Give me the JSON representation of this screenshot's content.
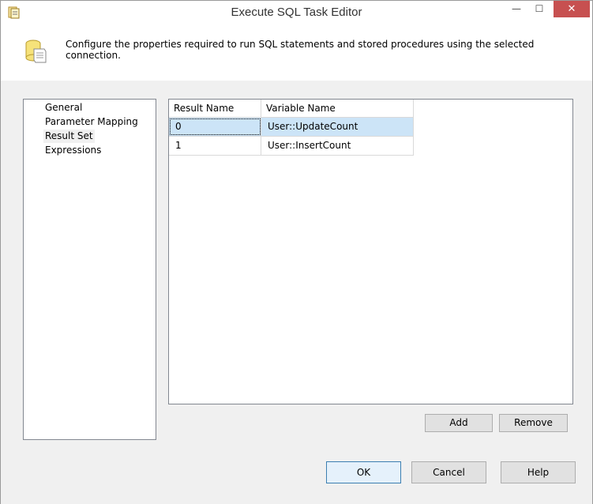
{
  "window": {
    "title": "Execute SQL Task Editor",
    "minimize_glyph": "—",
    "maximize_glyph": "☐",
    "close_glyph": "✕"
  },
  "header": {
    "description": "Configure the properties required to run SQL statements and stored procedures using the selected connection."
  },
  "nav": {
    "items": [
      {
        "label": "General"
      },
      {
        "label": "Parameter Mapping"
      },
      {
        "label": "Result Set"
      },
      {
        "label": "Expressions"
      }
    ],
    "selected": "Result Set"
  },
  "grid": {
    "columns": [
      "Result Name",
      "Variable Name"
    ],
    "rows": [
      {
        "result_name": "0",
        "variable_name": "User::UpdateCount"
      },
      {
        "result_name": "1",
        "variable_name": "User::InsertCount"
      }
    ]
  },
  "buttons": {
    "add": "Add",
    "remove": "Remove",
    "ok": "OK",
    "cancel": "Cancel",
    "help": "Help"
  },
  "colors": {
    "selection": "#cce4f7",
    "close_button": "#c75050",
    "default_button_border": "#3c7fb1"
  }
}
